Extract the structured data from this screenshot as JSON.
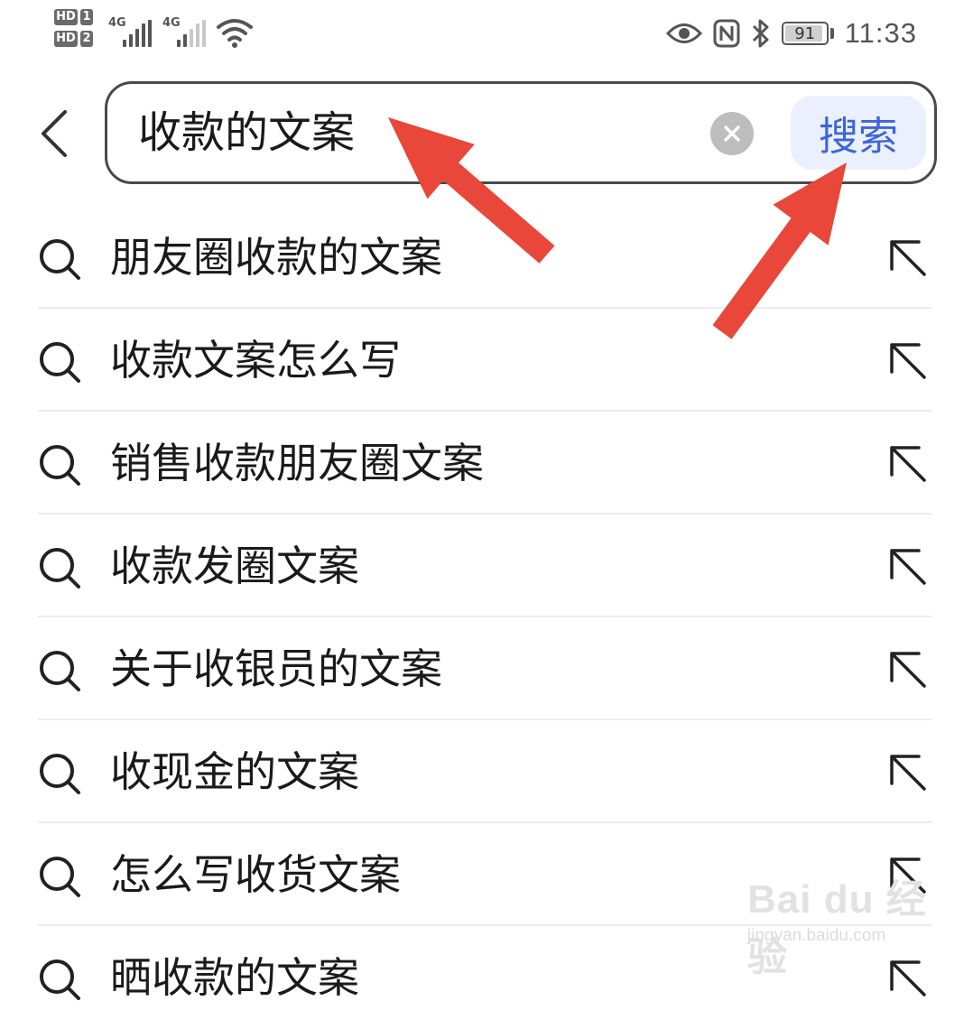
{
  "status_bar": {
    "sim1_badge": "HD",
    "sim1_number": "1",
    "sim2_badge": "HD",
    "sim2_number": "2",
    "network1": "4G",
    "network2": "4G",
    "battery_level": "91",
    "time": "11:33"
  },
  "search": {
    "query": "收款的文案",
    "search_button_label": "搜索",
    "accent_color": "#3f64d8"
  },
  "suggestions": [
    "朋友圈收款的文案",
    "收款文案怎么写",
    "销售收款朋友圈文案",
    "收款发圈文案",
    "关于收银员的文案",
    "收现金的文案",
    "怎么写收货文案",
    "晒收款的文案"
  ],
  "annotation": {
    "arrow_color": "#e8473a"
  },
  "watermark": {
    "logo": "Bai du 经验",
    "url": "jingyan.baidu.com"
  }
}
